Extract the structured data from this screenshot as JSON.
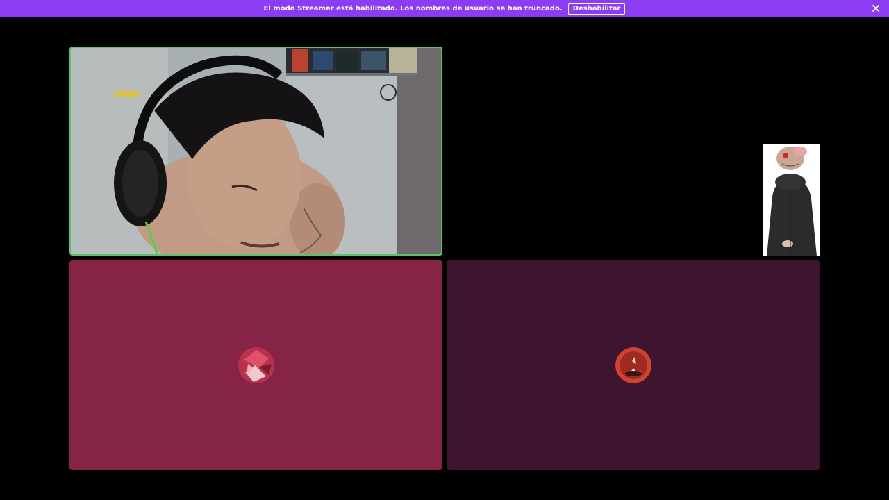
{
  "banner": {
    "message": "El modo Streamer está habilitado. Los nombres de usuario se han truncado.",
    "disable_label": "Deshabilitar",
    "close_icon": "close-icon",
    "background": "#8c3cf4"
  },
  "tiles": {
    "video": {
      "speaking_border": "#5fbf6e"
    },
    "participant_a": {
      "background": "#862447"
    },
    "participant_b": {
      "background": "#3d1530"
    }
  }
}
